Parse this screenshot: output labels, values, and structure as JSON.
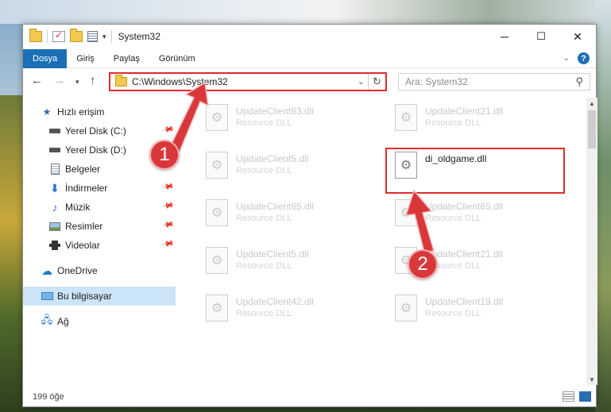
{
  "window": {
    "title": "System32",
    "controls": {
      "minimize": "─",
      "maximize": "☐",
      "close": "✕"
    }
  },
  "ribbon": {
    "tabs": [
      {
        "label": "Dosya",
        "active": true
      },
      {
        "label": "Giriş"
      },
      {
        "label": "Paylaş"
      },
      {
        "label": "Görünüm"
      }
    ],
    "help": "?"
  },
  "nav": {
    "address": "C:\\Windows\\System32",
    "search_placeholder": "Ara: System32"
  },
  "sidebar": {
    "items": [
      {
        "label": "Hızlı erişim",
        "icon": "star-icon"
      },
      {
        "label": "Yerel Disk (C:)",
        "icon": "disk-icon",
        "pinned": true
      },
      {
        "label": "Yerel Disk (D:)",
        "icon": "disk-icon"
      },
      {
        "label": "Belgeler",
        "icon": "documents-icon"
      },
      {
        "label": "İndirmeler",
        "icon": "download-icon",
        "pinned": true
      },
      {
        "label": "Müzik",
        "icon": "music-icon",
        "pinned": true
      },
      {
        "label": "Resimler",
        "icon": "pictures-icon",
        "pinned": true
      },
      {
        "label": "Videolar",
        "icon": "videos-icon",
        "pinned": true
      },
      {
        "label": "OneDrive",
        "icon": "cloud-icon"
      },
      {
        "label": "Bu bilgisayar",
        "icon": "computer-icon",
        "selected": true
      },
      {
        "label": "Ağ",
        "icon": "network-icon"
      }
    ]
  },
  "files": [
    {
      "name": "UpdateClient63.dll",
      "type": "Resource DLL"
    },
    {
      "name": "UpdateClient21.dll",
      "type": "Resource DLL"
    },
    {
      "name": "UpdateClient5.dll",
      "type": "Resource DLL"
    },
    {
      "name": "di_oldgame.dll",
      "type": "",
      "highlighted": true
    },
    {
      "name": "UpdateClient65.dll",
      "type": "Resource DLL"
    },
    {
      "name": "UpdateClient65.dll",
      "type": "Resource DLL"
    },
    {
      "name": "UpdateClient5.dll",
      "type": "Resource DLL"
    },
    {
      "name": "UpdateClient21.dll",
      "type": "Resource DLL"
    },
    {
      "name": "UpdateClient42.dll",
      "type": "Resource DLL"
    },
    {
      "name": "UpdateClient19.dll",
      "type": "Resource DLL"
    }
  ],
  "status": {
    "count": "199 öğe"
  },
  "annotations": {
    "step1": "1",
    "step2": "2",
    "color": "#e02b2b"
  }
}
